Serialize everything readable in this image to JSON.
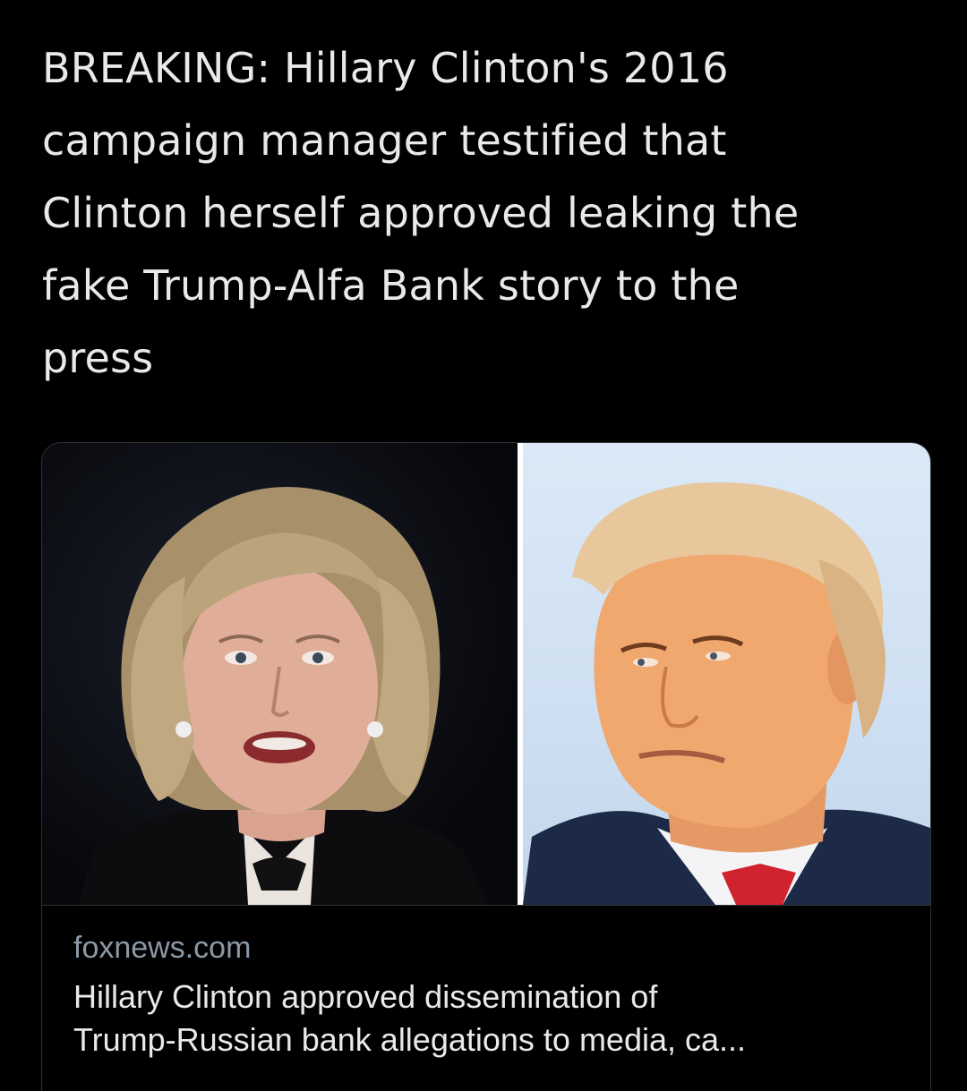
{
  "tweet": {
    "text": "BREAKING: Hillary Clinton's 2016 campaign manager testified that Clinton herself approved leaking the fake Trump-Alfa Bank story to the press",
    "lines": [
      "BREAKING: Hillary Clinton's 2016",
      "campaign manager testified that",
      "Clinton herself approved leaking the",
      "fake Trump-Alfa Bank story to the",
      "press"
    ]
  },
  "link_card": {
    "domain": "foxnews.com",
    "title_lines": [
      "Hillary Clinton approved dissemination of",
      "Trump-Russian bank allegations to media, ca..."
    ],
    "images": [
      {
        "icon": "portrait-photo",
        "alt": ""
      },
      {
        "icon": "portrait-photo",
        "alt": ""
      }
    ]
  },
  "colors": {
    "background": "#000000",
    "text_primary": "#e7e9ea",
    "text_secondary": "#8b98a5",
    "card_border": "#2f3336"
  }
}
